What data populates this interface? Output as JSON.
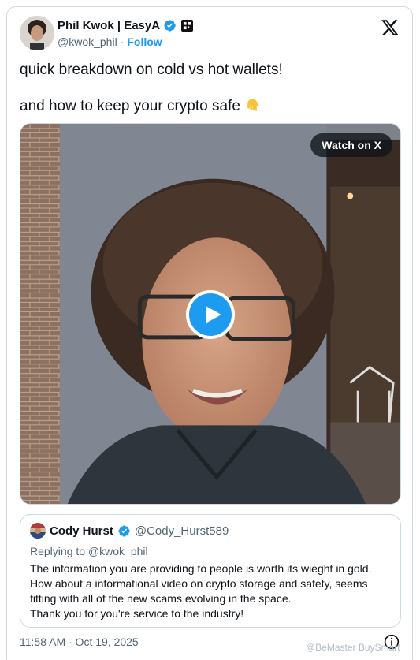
{
  "author": {
    "name": "Phil Kwok | EasyA",
    "handle": "@kwok_phil",
    "separator": "·",
    "follow_label": "Follow"
  },
  "tweet": {
    "lines": [
      "quick breakdown on cold vs hot wallets!",
      "and how to keep your crypto safe"
    ],
    "emoji_icon": "pointing-down-hand-icon"
  },
  "media": {
    "watch_label": "Watch on X",
    "play_icon": "play-icon"
  },
  "quote": {
    "name": "Cody Hurst",
    "handle": "@Cody_Hurst589",
    "replying_prefix": "Replying to",
    "replying_handle": "@kwok_phil",
    "body_lines": [
      "The information you are providing to people is worth its wieght in gold.",
      "How about a informational video on crypto storage and safety, seems",
      "fitting with all of the new scams evolving in the space.",
      "Thank you for you're service to the industry!"
    ]
  },
  "footer": {
    "timestamp": "11:58 AM · Oct 19, 2025",
    "watermark": "@BeMaster BuySmart"
  },
  "colors": {
    "accent": "#1d9bf0",
    "text": "#0f1419",
    "secondary": "#536471",
    "border": "#cfd9de"
  }
}
